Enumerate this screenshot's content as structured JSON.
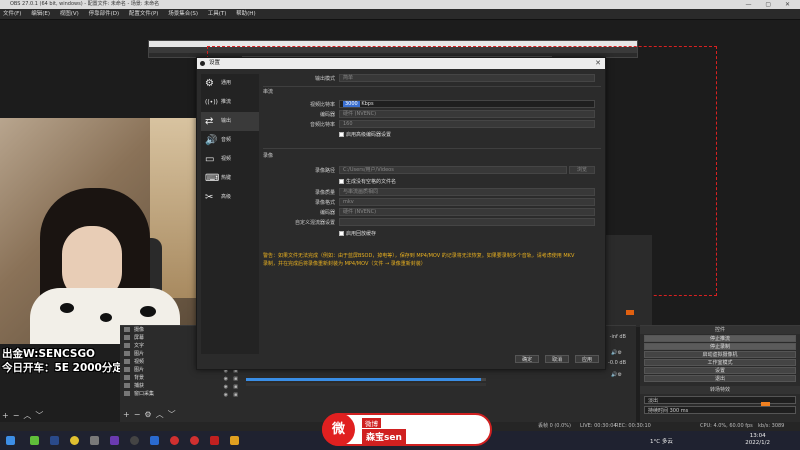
{
  "window": {
    "title": "OBS 27.0.1 (64 bit, windows) - 配置文件: 未命名 - 场景: 未命名",
    "controls": "— ▢ ✕"
  },
  "menubar": [
    "文件(F)",
    "编辑(E)",
    "视图(V)",
    "停靠部件(D)",
    "配置文件(P)",
    "场景集合(S)",
    "工具(T)",
    "帮助(H)"
  ],
  "overlay": {
    "line1": "出金W:SENCSGO",
    "line2": "今日开车：5E 2000分定级赛"
  },
  "settings": {
    "title": "设置",
    "close": "✕",
    "nav": [
      {
        "label": "通用",
        "icon": "⚙"
      },
      {
        "label": "推流",
        "icon": "((•))"
      },
      {
        "label": "输出",
        "icon": "⇄"
      },
      {
        "label": "音频",
        "icon": "🔊"
      },
      {
        "label": "视频",
        "icon": "▭"
      },
      {
        "label": "热键",
        "icon": "⌨"
      },
      {
        "label": "高级",
        "icon": "✂"
      }
    ],
    "output_mode_label": "输出模式",
    "output_mode_value": "简单",
    "streaming_section": "串流",
    "video_bitrate_label": "视频比特率",
    "video_bitrate_value": "3000",
    "video_bitrate_unit": "Kbps",
    "encoder_label": "编码器",
    "encoder_value": "硬件 (NVENC)",
    "audio_bitrate_label": "音频比特率",
    "audio_bitrate_value": "160",
    "enable_advanced_encoder": "启用高级编码器设置",
    "recording_section": "录像",
    "recording_path_label": "录像路径",
    "recording_path_value": "C:/Users/用户/Videos",
    "browse_label": "浏览",
    "no_space_filename": "生成没有空格的文件名",
    "recording_quality_label": "录像质量",
    "recording_quality_value": "与串流画质相同",
    "recording_format_label": "录像格式",
    "recording_format_value": "mkv",
    "rec_encoder_label": "编码器",
    "rec_encoder_value": "硬件 (NVENC)",
    "custom_muxer_label": "自定义混流器设置",
    "enable_replay_buffer": "启用回放缓存",
    "warning_line1": "警告：如果文件无法完成（例如：由于蓝屏BSOD，掉电等），保存到 MP4/MOV 的记录将无法恢复。如果要录制多个音轨，请考虑使用 MKV",
    "warning_line2": "录制，并在完成后将录像重新封装为 MP4/MOV（文件 → 录像重新封装）",
    "ok": "确定",
    "cancel": "取消",
    "apply": "应用"
  },
  "sources": {
    "items": [
      "摄像",
      "屏幕",
      "文字",
      "图片",
      "视频",
      "图片",
      "背景",
      "捕获",
      "窗口采集"
    ]
  },
  "mixer": {
    "tracks": [
      {
        "db": "-inf dB",
        "level": 0.0
      },
      {
        "db": "-0.0 dB",
        "level": 0.98
      }
    ]
  },
  "controls": {
    "header": "控件",
    "buttons": [
      "停止推流",
      "停止录制",
      "启动虚拟摄像机",
      "工作室模式",
      "设置",
      "退出"
    ],
    "transition_header": "转场特效",
    "transition_value": "淡出",
    "duration_label": "持续时间",
    "duration_value": "300 ms"
  },
  "statusbar": {
    "dropped": "丢帧 0 (0.0%)",
    "live": "LIVE: 00:30:04",
    "rec": "REC: 00:30:10",
    "cpu": "CPU: 4.0%, 60.00 fps",
    "kbps": "kb/s: 3089"
  },
  "taskbar": {
    "weather": "1°C 多云",
    "time": "13:04",
    "date": "2022/1/2"
  },
  "weibo": {
    "logo": "微",
    "platform": "微博",
    "name": "森宝sen"
  },
  "colors": {
    "accent": "#3a6fd0",
    "warning": "#e8b020",
    "record_red": "#d92020",
    "weibo_red": "#d02020"
  }
}
